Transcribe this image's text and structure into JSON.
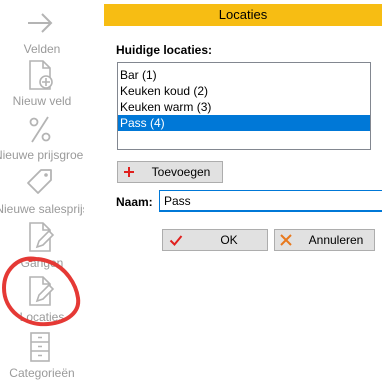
{
  "sidebar": {
    "items": [
      {
        "label": "Velden",
        "icon": "arrow-right-icon"
      },
      {
        "label": "Nieuw veld",
        "icon": "new-document-icon"
      },
      {
        "label": "Nieuwe prijsgroep",
        "icon": "percent-icon"
      },
      {
        "label": "Nieuwe salesprijs",
        "icon": "price-tag-icon"
      },
      {
        "label": "Gangen",
        "icon": "edit-document-icon"
      },
      {
        "label": "Locaties",
        "icon": "edit-document-icon"
      },
      {
        "label": "Categorieën",
        "icon": "cabinet-icon"
      }
    ],
    "text_color": "#9a9a9a",
    "highlight_color": "#e53935"
  },
  "dialog": {
    "title": "Locaties",
    "title_bg": "#f7bd13",
    "list_label": "Huidige locaties:",
    "locations": [
      {
        "label": "Bar (1)",
        "selected": false
      },
      {
        "label": "Keuken koud (2)",
        "selected": false
      },
      {
        "label": "Keuken warm (3)",
        "selected": false
      },
      {
        "label": "Pass (4)",
        "selected": true
      }
    ],
    "selection_color": "#0078d7",
    "add_button": "Toevoegen",
    "name_label": "Naam:",
    "name_value": "Pass",
    "ok_button": "OK",
    "cancel_button": "Annuleren"
  }
}
